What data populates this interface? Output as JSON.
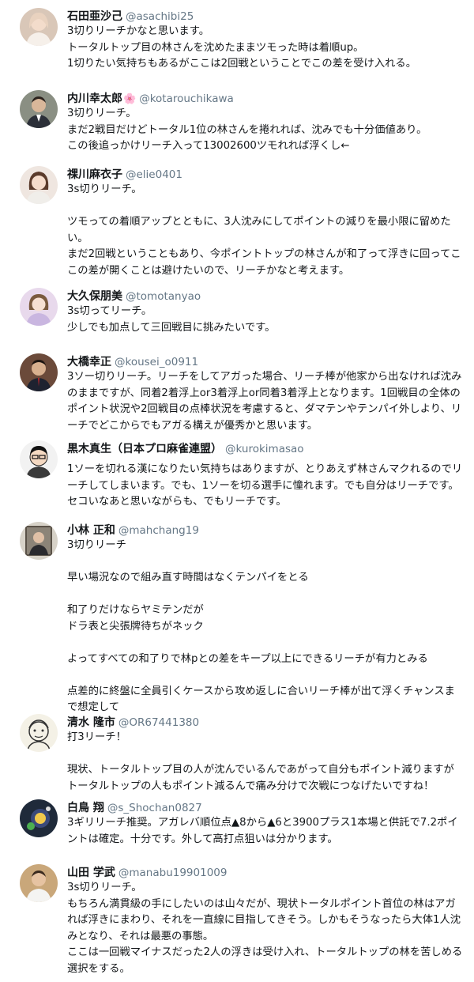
{
  "tweets": [
    {
      "name": "石田亜沙己",
      "badge": "",
      "handle": "@asachibi25",
      "avatar_icon": "user-avatar-icon",
      "avatar_bg": "#d9c7b8",
      "text": "3切りリーチかなと思います。\nトータルトップ目の林さんを沈めたままツモった時は着順up。\n1切りたい気持ちもあるがここは2回戦ということでこの差を受け入れる。"
    },
    {
      "name": "内川幸太郎",
      "badge": "🌸",
      "handle": "@kotarouchikawa",
      "avatar_icon": "user-avatar-icon",
      "avatar_bg": "#8a8f83",
      "text": "3切りリーチ。\nまだ2戦目だけどトータル1位の林さんを捲れれば、沈みでも十分価値あり。\nこの後追っかけリーチ入って13002600ツモれれば浮くし←"
    },
    {
      "name": "祼川麻衣子",
      "badge": "",
      "handle": "@elie0401",
      "avatar_icon": "user-avatar-icon",
      "avatar_bg": "#efe6e0",
      "text": "3s切りリーチ。\n\nツモっての着順アップとともに、3人沈みにしてポイントの減りを最小限に留めたい。\nまだ2回戦ということもあり、今ポイントトップの林さんが和了って浮きに回ってここの差が開くことは避けたいので、リーチかなと考えます。"
    },
    {
      "name": "大久保朋美",
      "badge": "",
      "handle": "@tomotanyao",
      "avatar_icon": "user-avatar-icon",
      "avatar_bg": "#e8d9ec",
      "text": "3s切ってリーチ。\n少しでも加点して三回戦目に挑みたいです。"
    },
    {
      "name": "大橋幸正",
      "badge": "",
      "handle": "@kousei_o0911",
      "avatar_icon": "user-avatar-icon",
      "avatar_bg": "#6b4a3a",
      "text": "3ソー切りリーチ。リーチをしてアガった場合、リーチ棒が他家から出なければ沈みのままですが、同着2着浮上or3着浮上or同着3着浮上となります。1回戦目の全体のポイント状況や2回戦目の点棒状況を考慮すると、ダマテンやテンパイ外しより、リーチでどこからでもアガる構えが優秀かと思います。"
    },
    {
      "name": "黒木真生（日本プロ麻雀連盟）",
      "badge": "",
      "handle": "@kurokimasao",
      "avatar_icon": "user-avatar-icon",
      "avatar_bg": "#f2f2f2",
      "text": "1ソーを切れる漢になりたい気持ちはありますが、とりあえず林さんマクれるのでリーチしてしまいます。でも、1ソーを切る選手に憧れます。でも自分はリーチです。セコいなあと思いながらも、でもリーチです。"
    },
    {
      "name": "小林 正和",
      "badge": "",
      "handle": "@mahchang19",
      "avatar_icon": "user-avatar-icon",
      "avatar_bg": "#d7d2c8",
      "text": "3切りリーチ\n\n早い場況なので組み直す時間はなくテンパイをとる\n\n和了りだけならヤミテンだが\nドラ表と尖張牌待ちがネック\n\nよってすべての和了りで林pとの差をキープ以上にできるリーチが有力とみる\n\n点差的に終盤に全員引くケースから攻め返しに合いリーチ棒が出て浮くチャンスまで想定して"
    },
    {
      "name": "清水 隆市",
      "badge": "",
      "handle": "@OR67441380",
      "avatar_icon": "user-avatar-icon",
      "avatar_bg": "#f4f1e6",
      "text": "打3リーチ！\n\n現状、トータルトップ目の人が沈んでいるんであがって自分もポイント減りますがトータルトップの人もポイント減るんで痛み分けで次戦につなげたいですね！"
    },
    {
      "name": "白鳥 翔",
      "badge": "",
      "handle": "@s_Shochan0827",
      "avatar_icon": "user-avatar-icon",
      "avatar_bg": "#1f2a3a",
      "text": "3ギリリーチ推奨。アガレバ順位点▲8から▲6と3900プラス1本場と供託で7.2ポイントは確定。十分です。外して高打点狙いは分かります。"
    },
    {
      "name": "山田 学武",
      "badge": "",
      "handle": "@manabu19901009",
      "avatar_icon": "user-avatar-icon",
      "avatar_bg": "#c9a77a",
      "text": "3s切りリーチ。\nもちろん満貫級の手にしたいのは山々だが、現状トータルポイント首位の林はアガれば浮きにまわり、それを一直線に目指してきそう。しかもそうなったら大体1人沈みとなり、それは最悪の事態。\nここは一回戦マイナスだった2人の浮きは受け入れ、トータルトップの林を苦しめる選択をする。"
    }
  ]
}
